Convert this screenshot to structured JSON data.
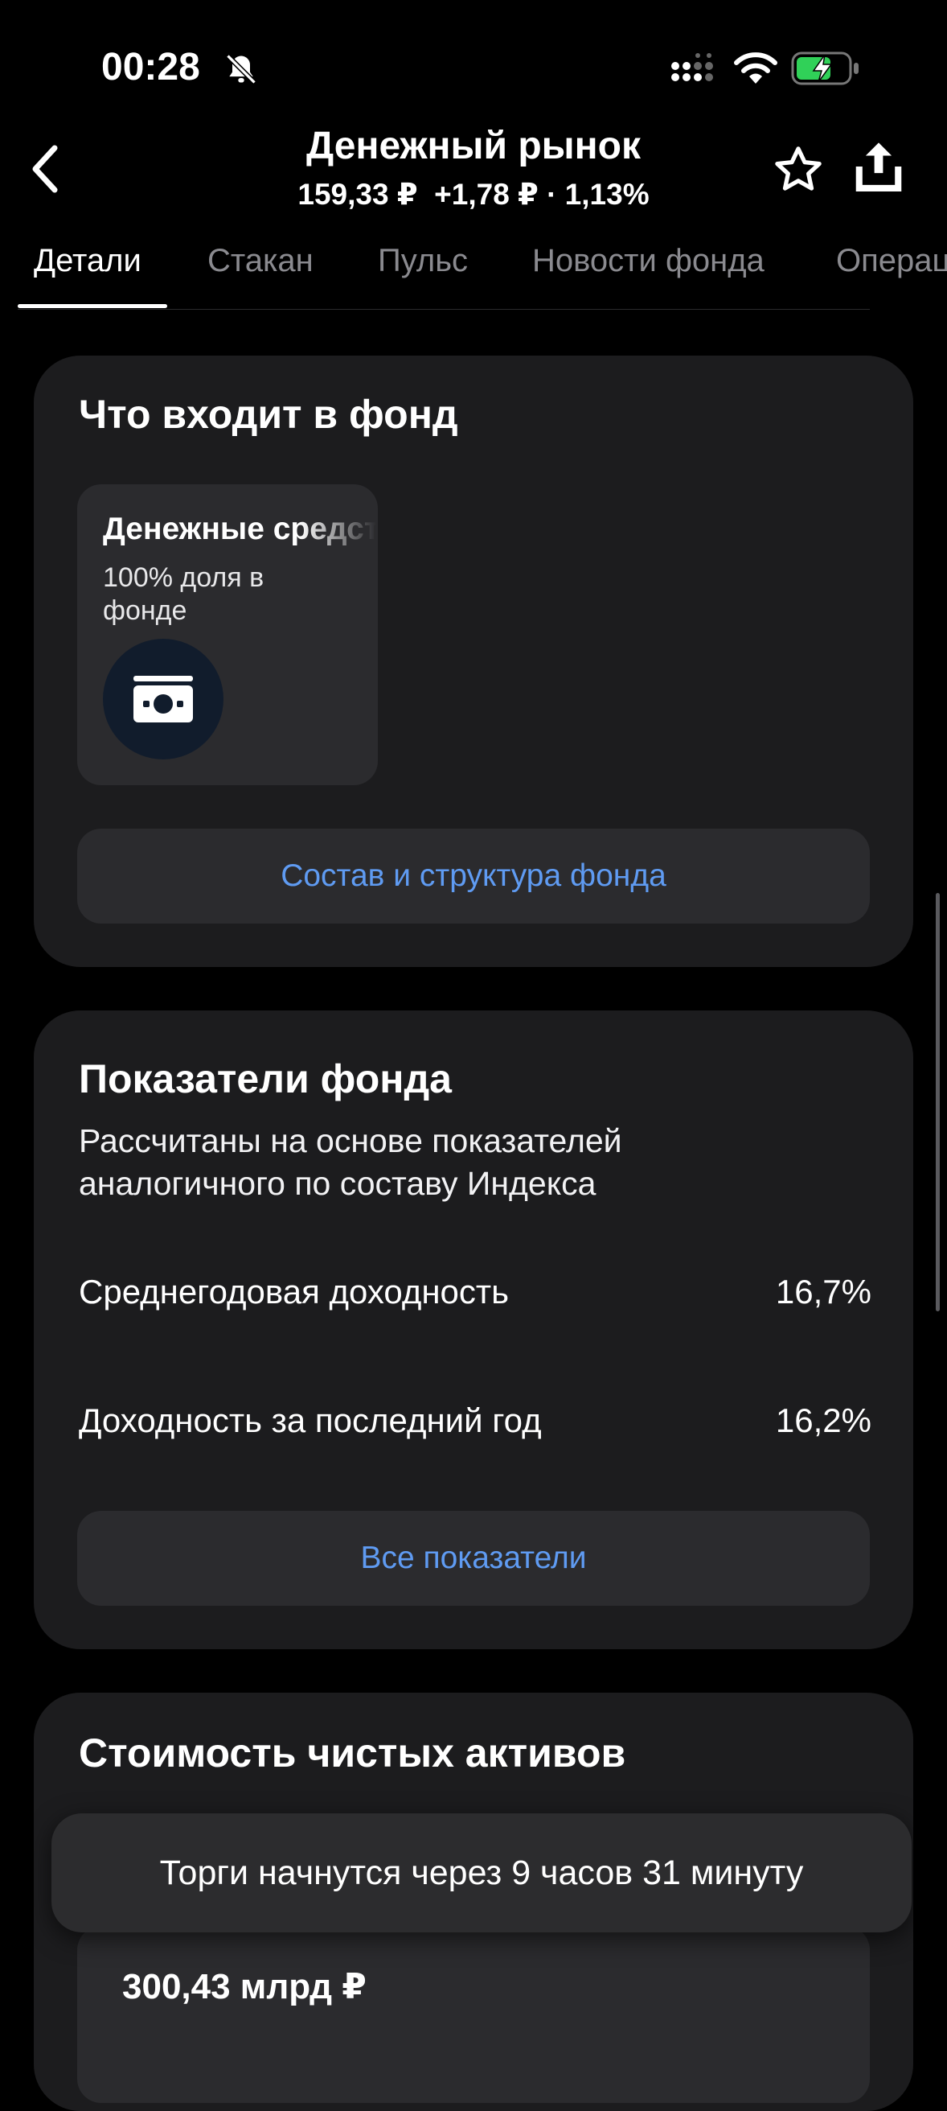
{
  "status_bar": {
    "time": "00:28"
  },
  "header": {
    "title": "Денежный рынок",
    "price": "159,33 ₽",
    "change": "+1,78 ₽ · 1,13%"
  },
  "tabs": [
    {
      "label": "Детали",
      "active": true
    },
    {
      "label": "Стакан"
    },
    {
      "label": "Пульс"
    },
    {
      "label": "Новости фонда"
    },
    {
      "label": "Операц"
    }
  ],
  "composition": {
    "title": "Что входит в фонд",
    "item_name": "Денежные средства",
    "item_share": "100% доля в фонде",
    "button": "Состав и структура фонда"
  },
  "metrics": {
    "title": "Показатели фонда",
    "subtitle": "Рассчитаны на основе показателей аналогичного по составу Индекса",
    "rows": [
      {
        "label": "Среднегодовая доходность",
        "value": "16,7%"
      },
      {
        "label": "Доходность за последний год",
        "value": "16,2%"
      }
    ],
    "button": "Все показатели"
  },
  "nav": {
    "title": "Стоимость чистых активов",
    "value": "300,43 млрд ₽"
  },
  "toast": {
    "text": "Торги начнутся через 9 часов 31 минуту"
  },
  "colors": {
    "accent": "#5f9bf2",
    "card": "#1c1c1e",
    "battery": "#30d158"
  }
}
